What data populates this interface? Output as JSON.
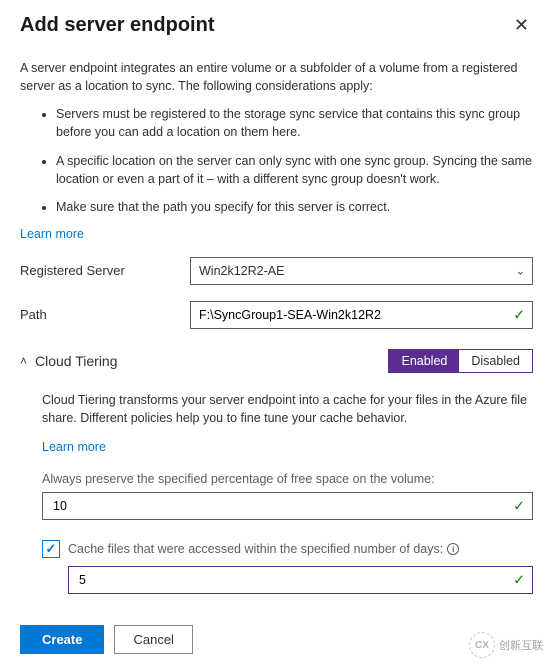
{
  "header": {
    "title": "Add server endpoint",
    "close_symbol": "✕"
  },
  "intro": {
    "description": "A server endpoint integrates an entire volume or a subfolder of a volume from a registered server as a location to sync. The following considerations apply:",
    "bullets": [
      "Servers must be registered to the storage sync service that contains this sync group before you can add a location on them here.",
      "A specific location on the server can only sync with one sync group. Syncing the same location or even a part of it – with a different sync group doesn't work.",
      "Make sure that the path you specify for this server is correct."
    ],
    "learn_more": "Learn more"
  },
  "form": {
    "registered_server": {
      "label": "Registered Server",
      "value": "Win2k12R2-AE"
    },
    "path": {
      "label": "Path",
      "value": "F:\\SyncGroup1-SEA-Win2k12R2"
    }
  },
  "cloud_tiering": {
    "expand_symbol": "˄",
    "title": "Cloud Tiering",
    "toggle": {
      "enabled": "Enabled",
      "disabled": "Disabled",
      "active": "Enabled"
    },
    "description": "Cloud Tiering transforms your server endpoint into a cache for your files in the Azure file share. Different policies help you to fine tune your cache behavior.",
    "learn_more": "Learn more",
    "free_space": {
      "label": "Always preserve the specified percentage of free space on the volume:",
      "value": "10"
    },
    "cache_days": {
      "checked": true,
      "label": "Cache files that were accessed within the specified number of days:",
      "value": "5"
    }
  },
  "footer": {
    "create": "Create",
    "cancel": "Cancel"
  },
  "watermark": {
    "logo": "CX",
    "text": "创新互联"
  }
}
